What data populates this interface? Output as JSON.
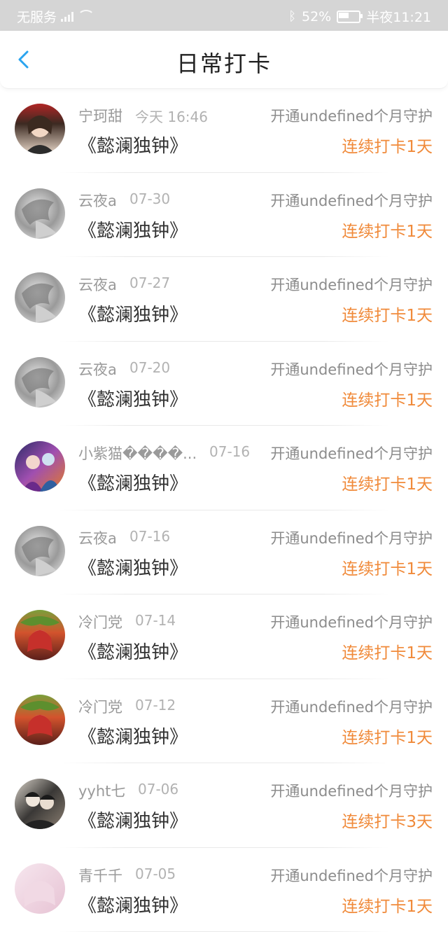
{
  "status_bar": {
    "carrier": "无服务",
    "battery": "52%",
    "time": "半夜11:21",
    "battery_level": 0.52
  },
  "header": {
    "title": "日常打卡",
    "back_icon": "chevron-left-icon",
    "accent": "#2aa4ef"
  },
  "colors": {
    "streak": "#f08a3a",
    "name": "#9a9a9a"
  },
  "rows": [
    {
      "name": "宁珂甜",
      "date": "今天 16:46",
      "guard": "开通undefined个月守护",
      "group": "《懿澜独钟》",
      "streak": "连续打卡1天",
      "avatar": "portrait-girl"
    },
    {
      "name": "云夜a",
      "date": "07-30",
      "guard": "开通undefined个月守护",
      "group": "《懿澜独钟》",
      "streak": "连续打卡1天",
      "avatar": "grey-sketch"
    },
    {
      "name": "云夜a",
      "date": "07-27",
      "guard": "开通undefined个月守护",
      "group": "《懿澜独钟》",
      "streak": "连续打卡1天",
      "avatar": "grey-sketch"
    },
    {
      "name": "云夜a",
      "date": "07-20",
      "guard": "开通undefined个月守护",
      "group": "《懿澜独钟》",
      "streak": "连续打卡1天",
      "avatar": "grey-sketch"
    },
    {
      "name": "小紫猫����...",
      "date": "07-16",
      "guard": "开通undefined个月守护",
      "group": "《懿澜独钟》",
      "streak": "连续打卡1天",
      "avatar": "purple-anime"
    },
    {
      "name": "云夜a",
      "date": "07-16",
      "guard": "开通undefined个月守护",
      "group": "《懿澜独钟》",
      "streak": "连续打卡1天",
      "avatar": "grey-sketch"
    },
    {
      "name": "冷门党",
      "date": "07-14",
      "guard": "开通undefined个月守护",
      "group": "《懿澜独钟》",
      "streak": "连续打卡1天",
      "avatar": "red-anime"
    },
    {
      "name": "冷门党",
      "date": "07-12",
      "guard": "开通undefined个月守护",
      "group": "《懿澜独钟》",
      "streak": "连续打卡1天",
      "avatar": "red-anime"
    },
    {
      "name": "yyht七",
      "date": "07-06",
      "guard": "开通undefined个月守护",
      "group": "《懿澜独钟》",
      "streak": "连续打卡3天",
      "avatar": "dark-duo"
    },
    {
      "name": "青千千",
      "date": "07-05",
      "guard": "开通undefined个月守护",
      "group": "《懿澜独钟》",
      "streak": "连续打卡1天",
      "avatar": "pink-anime"
    }
  ]
}
